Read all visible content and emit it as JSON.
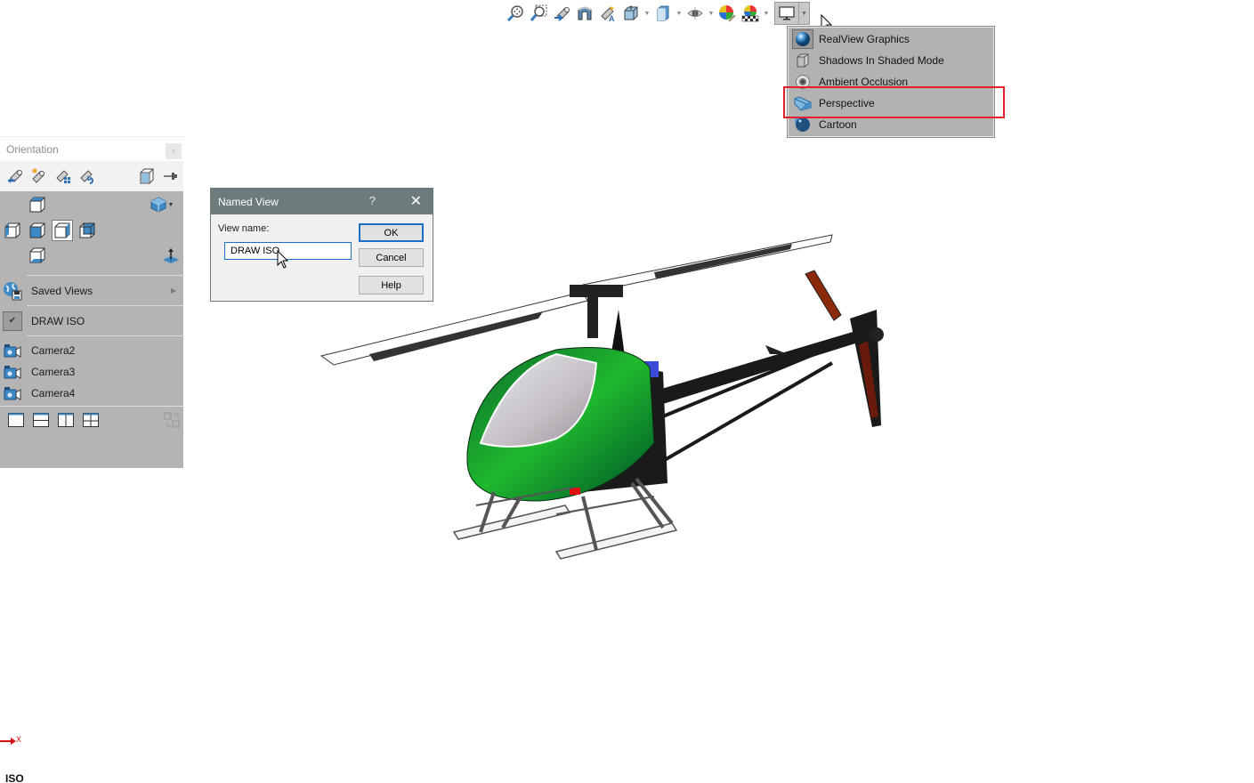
{
  "hud_toolbar": {
    "buttons": [
      {
        "icon": "zoom-to-fit-icon",
        "label": "Zoom to Fit"
      },
      {
        "icon": "zoom-to-area-icon",
        "label": "Zoom to Area"
      },
      {
        "icon": "previous-view-icon",
        "label": "Previous View"
      },
      {
        "icon": "section-view-icon",
        "label": "Section View"
      },
      {
        "icon": "dynamic-annotation-views-icon",
        "label": "Dynamic Annotation Views"
      },
      {
        "icon": "view-orientation-icon",
        "label": "View Orientation",
        "dropdown": true
      },
      {
        "icon": "display-style-icon",
        "label": "Display Style",
        "dropdown": true
      },
      {
        "icon": "hide-show-items-icon",
        "label": "Hide/Show Items",
        "dropdown": true
      },
      {
        "icon": "edit-appearance-icon",
        "label": "Edit Appearance"
      },
      {
        "icon": "apply-scene-icon",
        "label": "Apply Scene",
        "dropdown": true
      },
      {
        "icon": "view-settings-icon",
        "label": "View Settings",
        "dropdown": true,
        "active": true
      }
    ]
  },
  "view_settings_menu": {
    "items": [
      {
        "icon": "realview-graphics-icon",
        "label": "RealView Graphics",
        "checked": true
      },
      {
        "icon": "shadows-icon",
        "label": "Shadows In Shaded Mode",
        "checked": false
      },
      {
        "icon": "ambient-occlusion-icon",
        "label": "Ambient Occlusion",
        "checked": false
      },
      {
        "icon": "perspective-icon",
        "label": "Perspective",
        "checked": false,
        "highlighted": true
      },
      {
        "icon": "cartoon-icon",
        "label": "Cartoon",
        "checked": false
      }
    ],
    "highlight_color": "#e0202a"
  },
  "orientation_panel": {
    "title": "Orientation",
    "close_label": "x",
    "tools": [
      {
        "icon": "previous-view-icon",
        "label": "Previous View"
      },
      {
        "icon": "new-view-icon",
        "label": "New View"
      },
      {
        "icon": "update-standard-views-icon",
        "label": "Update Standard Views"
      },
      {
        "icon": "reset-standard-views-icon",
        "label": "Reset Standard Views"
      },
      {
        "icon": "view-selector-icon",
        "label": "View Selector"
      },
      {
        "icon": "pin-icon",
        "label": "Pin"
      }
    ],
    "standard_views": [
      {
        "name": "top",
        "selected": false
      },
      {
        "name": "left",
        "selected": false
      },
      {
        "name": "front",
        "selected": false
      },
      {
        "name": "right",
        "selected": true
      },
      {
        "name": "back",
        "selected": false
      },
      {
        "name": "bottom",
        "selected": false
      }
    ],
    "saved_views_label": "Saved Views",
    "named_views": [
      {
        "label": "DRAW ISO",
        "checked": true
      }
    ],
    "cameras": [
      "Camera2",
      "Camera3",
      "Camera4"
    ],
    "viewport_layouts": [
      "single-view",
      "two-view-horizontal",
      "two-view-vertical",
      "four-view"
    ]
  },
  "named_view_dialog": {
    "title": "Named View",
    "help_glyph": "?",
    "close_glyph": "✕",
    "field_label": "View name:",
    "field_value": "DRAW ISO",
    "buttons": {
      "ok": "OK",
      "cancel": "Cancel",
      "help": "Help"
    }
  },
  "triad": {
    "axis_label": "X"
  },
  "view_label": "ISO"
}
